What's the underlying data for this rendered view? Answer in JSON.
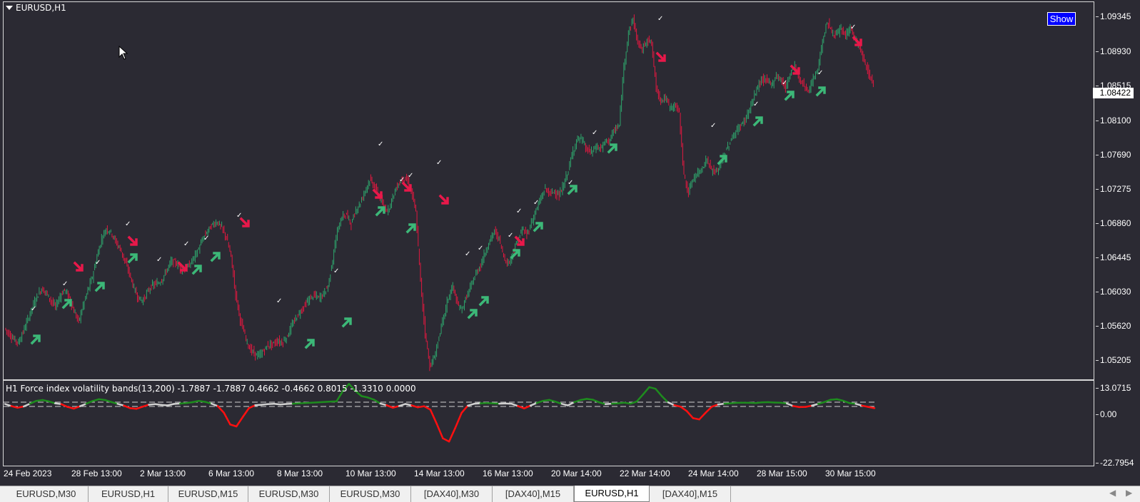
{
  "chart": {
    "symbol_label": "EURUSD,H1",
    "show_button_label": "Show",
    "current_price": "1.08422",
    "price_ticks": [
      "1.09345",
      "1.08930",
      "1.08515",
      "1.08100",
      "1.07690",
      "1.07275",
      "1.06860",
      "1.06445",
      "1.06030",
      "1.05620",
      "1.05205"
    ],
    "time_ticks": [
      "24 Feb 2023",
      "28 Feb 13:00",
      "2 Mar 13:00",
      "6 Mar 13:00",
      "8 Mar 13:00",
      "10 Mar 13:00",
      "14 Mar 13:00",
      "16 Mar 13:00",
      "20 Mar 14:00",
      "22 Mar 14:00",
      "24 Mar 14:00",
      "28 Mar 15:00",
      "30 Mar 15:00"
    ],
    "bull_color": "#2ea36b",
    "bear_color": "#e0183f",
    "price_path": [
      1.0565,
      1.0558,
      1.0552,
      1.0548,
      1.0561,
      1.0575,
      1.059,
      1.0603,
      1.0612,
      1.0607,
      1.0598,
      1.059,
      1.0603,
      1.0611,
      1.0601,
      1.0585,
      1.0573,
      1.0592,
      1.061,
      1.0626,
      1.065,
      1.0671,
      1.0683,
      1.0679,
      1.0668,
      1.0659,
      1.0645,
      1.063,
      1.0612,
      1.06,
      1.0598,
      1.0609,
      1.0616,
      1.0618,
      1.0622,
      1.0633,
      1.0644,
      1.0643,
      1.0636,
      1.0634,
      1.064,
      1.0649,
      1.0659,
      1.0672,
      1.0681,
      1.0688,
      1.0691,
      1.0684,
      1.0672,
      1.065,
      1.0605,
      1.0575,
      1.0556,
      1.0541,
      1.0535,
      1.0532,
      1.0538,
      1.0545,
      1.0546,
      1.055,
      1.0548,
      1.0554,
      1.0566,
      1.0577,
      1.0585,
      1.0593,
      1.06,
      1.0604,
      1.0601,
      1.0606,
      1.0615,
      1.0647,
      1.068,
      1.0697,
      1.07,
      1.0688,
      1.0705,
      1.0714,
      1.0728,
      1.0741,
      1.0734,
      1.0722,
      1.0709,
      1.0705,
      1.0721,
      1.0734,
      1.0742,
      1.0741,
      1.0728,
      1.0702,
      1.062,
      1.056,
      1.052,
      1.053,
      1.0555,
      1.0578,
      1.0601,
      1.0615,
      1.0592,
      1.0588,
      1.0603,
      1.0616,
      1.063,
      1.064,
      1.0655,
      1.0669,
      1.068,
      1.0671,
      1.065,
      1.0641,
      1.0655,
      1.0669,
      1.0682,
      1.0676,
      1.069,
      1.0705,
      1.0718,
      1.0731,
      1.0724,
      1.0728,
      1.0721,
      1.0735,
      1.0753,
      1.0775,
      1.079,
      1.0788,
      1.0776,
      1.0774,
      1.078,
      1.0778,
      1.0786,
      1.0789,
      1.08,
      1.0805,
      1.0875,
      1.0915,
      1.0932,
      1.0903,
      1.0895,
      1.0908,
      1.0902,
      1.085,
      1.0835,
      1.0838,
      1.0826,
      1.083,
      1.082,
      1.0745,
      1.0725,
      1.0743,
      1.0748,
      1.0756,
      1.0765,
      1.0753,
      1.0749,
      1.0762,
      1.0774,
      1.0786,
      1.0796,
      1.0803,
      1.081,
      1.0822,
      1.0836,
      1.0852,
      1.086,
      1.0858,
      1.0854,
      1.0864,
      1.086,
      1.085,
      1.0868,
      1.0876,
      1.0859,
      1.0853,
      1.0846,
      1.086,
      1.0873,
      1.0905,
      1.0928,
      1.0916,
      1.0912,
      1.0919,
      1.0912,
      1.0922,
      1.0907,
      1.0898,
      1.0881,
      1.0867,
      1.0853
    ],
    "checkmark_glyph": "✓"
  },
  "indicator": {
    "label": "H1  Force index volatility bands(13,200) -1.7887 -1.7887 0.4662 -0.4662 0.8015 -1.3310 0.0000",
    "scale_ticks": [
      "13.0715",
      "0.00",
      "-22.7954"
    ],
    "positive_color": "#1e8c1e",
    "negative_color": "#ff1010",
    "neutral_color": "#d0d0d0",
    "series": [
      0.2,
      -0.8,
      -1.6,
      -1.0,
      0.4,
      2.1,
      2.6,
      1.8,
      0.6,
      0.1,
      -1.2,
      -2.0,
      -0.9,
      0.4,
      2.0,
      3.1,
      2.6,
      1.4,
      0.3,
      -0.6,
      -1.8,
      -2.1,
      -1.1,
      -0.2,
      0.1,
      -0.3,
      -0.5,
      0.2,
      0.5,
      0.8,
      1.3,
      2.1,
      1.5,
      0.4,
      -0.8,
      -4.0,
      -9.5,
      -10.4,
      -6.0,
      -1.8,
      -0.4,
      -0.2,
      0.1,
      0.3,
      -0.1,
      0.2,
      0.4,
      0.6,
      0.8,
      1.0,
      1.2,
      1.4,
      1.6,
      1.8,
      8.0,
      12.5,
      8.2,
      5.0,
      4.2,
      2.8,
      0.5,
      -0.4,
      -1.6,
      -0.8,
      0.2,
      -0.5,
      -1.4,
      -0.9,
      -2.5,
      -9.0,
      -16.0,
      -17.5,
      -11.0,
      -4.0,
      -0.6,
      0.3,
      0.6,
      0.8,
      0.6,
      0.4,
      0.5,
      0.3,
      -0.8,
      -1.9,
      -0.6,
      0.8,
      2.1,
      2.7,
      1.6,
      0.3,
      -0.5,
      1.3,
      2.6,
      3.3,
      2.8,
      1.2,
      0.1,
      0.4,
      0.6,
      1.0,
      0.4,
      1.7,
      6.0,
      10.5,
      9.5,
      5.0,
      1.2,
      -0.4,
      -1.1,
      -3.2,
      -6.5,
      -7.1,
      -4.0,
      -1.1,
      -0.1,
      0.4,
      0.6,
      0.9,
      1.0,
      0.9,
      0.8,
      1.2,
      1.3,
      1.1,
      1.0,
      0.5,
      -0.8,
      -1.3,
      -1.2,
      -0.6,
      0.2,
      1.4,
      2.8,
      3.1,
      2.2,
      0.8,
      0.3,
      -0.6,
      -1.2,
      -1.8
    ]
  },
  "tabs": [
    {
      "label": "EURUSD,M30",
      "active": false
    },
    {
      "label": "EURUSD,H1",
      "active": false
    },
    {
      "label": "EURUSD,M15",
      "active": false
    },
    {
      "label": "EURUSD,M30",
      "active": false
    },
    {
      "label": "EURUSD,M30",
      "active": false
    },
    {
      "label": "[DAX40],M30",
      "active": false
    },
    {
      "label": "[DAX40],M15",
      "active": false
    },
    {
      "label": "EURUSD,H1",
      "active": true
    },
    {
      "label": "[DAX40],M15",
      "active": false
    }
  ],
  "tab_scroll": {
    "left_glyph": "◀",
    "right_glyph": "▶"
  }
}
